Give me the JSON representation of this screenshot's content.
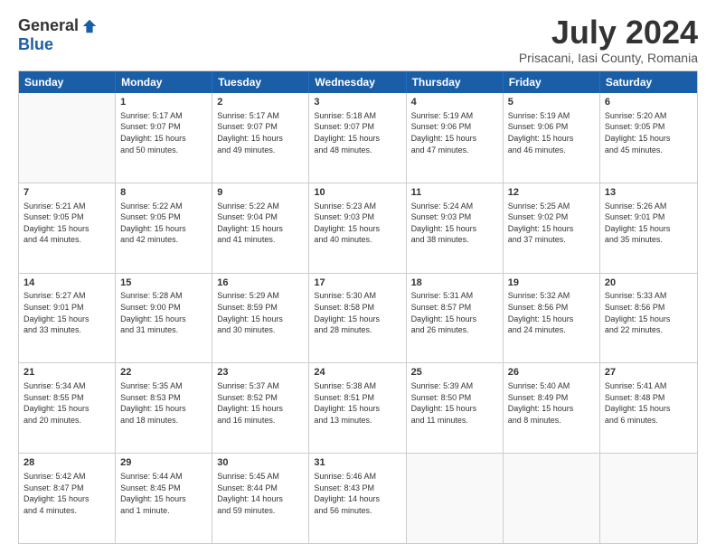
{
  "header": {
    "logo_general": "General",
    "logo_blue": "Blue",
    "month_title": "July 2024",
    "location": "Prisacani, Iasi County, Romania"
  },
  "days_of_week": [
    "Sunday",
    "Monday",
    "Tuesday",
    "Wednesday",
    "Thursday",
    "Friday",
    "Saturday"
  ],
  "weeks": [
    [
      {
        "day": "",
        "text": ""
      },
      {
        "day": "1",
        "text": "Sunrise: 5:17 AM\nSunset: 9:07 PM\nDaylight: 15 hours\nand 50 minutes."
      },
      {
        "day": "2",
        "text": "Sunrise: 5:17 AM\nSunset: 9:07 PM\nDaylight: 15 hours\nand 49 minutes."
      },
      {
        "day": "3",
        "text": "Sunrise: 5:18 AM\nSunset: 9:07 PM\nDaylight: 15 hours\nand 48 minutes."
      },
      {
        "day": "4",
        "text": "Sunrise: 5:19 AM\nSunset: 9:06 PM\nDaylight: 15 hours\nand 47 minutes."
      },
      {
        "day": "5",
        "text": "Sunrise: 5:19 AM\nSunset: 9:06 PM\nDaylight: 15 hours\nand 46 minutes."
      },
      {
        "day": "6",
        "text": "Sunrise: 5:20 AM\nSunset: 9:05 PM\nDaylight: 15 hours\nand 45 minutes."
      }
    ],
    [
      {
        "day": "7",
        "text": "Sunrise: 5:21 AM\nSunset: 9:05 PM\nDaylight: 15 hours\nand 44 minutes."
      },
      {
        "day": "8",
        "text": "Sunrise: 5:22 AM\nSunset: 9:05 PM\nDaylight: 15 hours\nand 42 minutes."
      },
      {
        "day": "9",
        "text": "Sunrise: 5:22 AM\nSunset: 9:04 PM\nDaylight: 15 hours\nand 41 minutes."
      },
      {
        "day": "10",
        "text": "Sunrise: 5:23 AM\nSunset: 9:03 PM\nDaylight: 15 hours\nand 40 minutes."
      },
      {
        "day": "11",
        "text": "Sunrise: 5:24 AM\nSunset: 9:03 PM\nDaylight: 15 hours\nand 38 minutes."
      },
      {
        "day": "12",
        "text": "Sunrise: 5:25 AM\nSunset: 9:02 PM\nDaylight: 15 hours\nand 37 minutes."
      },
      {
        "day": "13",
        "text": "Sunrise: 5:26 AM\nSunset: 9:01 PM\nDaylight: 15 hours\nand 35 minutes."
      }
    ],
    [
      {
        "day": "14",
        "text": "Sunrise: 5:27 AM\nSunset: 9:01 PM\nDaylight: 15 hours\nand 33 minutes."
      },
      {
        "day": "15",
        "text": "Sunrise: 5:28 AM\nSunset: 9:00 PM\nDaylight: 15 hours\nand 31 minutes."
      },
      {
        "day": "16",
        "text": "Sunrise: 5:29 AM\nSunset: 8:59 PM\nDaylight: 15 hours\nand 30 minutes."
      },
      {
        "day": "17",
        "text": "Sunrise: 5:30 AM\nSunset: 8:58 PM\nDaylight: 15 hours\nand 28 minutes."
      },
      {
        "day": "18",
        "text": "Sunrise: 5:31 AM\nSunset: 8:57 PM\nDaylight: 15 hours\nand 26 minutes."
      },
      {
        "day": "19",
        "text": "Sunrise: 5:32 AM\nSunset: 8:56 PM\nDaylight: 15 hours\nand 24 minutes."
      },
      {
        "day": "20",
        "text": "Sunrise: 5:33 AM\nSunset: 8:56 PM\nDaylight: 15 hours\nand 22 minutes."
      }
    ],
    [
      {
        "day": "21",
        "text": "Sunrise: 5:34 AM\nSunset: 8:55 PM\nDaylight: 15 hours\nand 20 minutes."
      },
      {
        "day": "22",
        "text": "Sunrise: 5:35 AM\nSunset: 8:53 PM\nDaylight: 15 hours\nand 18 minutes."
      },
      {
        "day": "23",
        "text": "Sunrise: 5:37 AM\nSunset: 8:52 PM\nDaylight: 15 hours\nand 16 minutes."
      },
      {
        "day": "24",
        "text": "Sunrise: 5:38 AM\nSunset: 8:51 PM\nDaylight: 15 hours\nand 13 minutes."
      },
      {
        "day": "25",
        "text": "Sunrise: 5:39 AM\nSunset: 8:50 PM\nDaylight: 15 hours\nand 11 minutes."
      },
      {
        "day": "26",
        "text": "Sunrise: 5:40 AM\nSunset: 8:49 PM\nDaylight: 15 hours\nand 8 minutes."
      },
      {
        "day": "27",
        "text": "Sunrise: 5:41 AM\nSunset: 8:48 PM\nDaylight: 15 hours\nand 6 minutes."
      }
    ],
    [
      {
        "day": "28",
        "text": "Sunrise: 5:42 AM\nSunset: 8:47 PM\nDaylight: 15 hours\nand 4 minutes."
      },
      {
        "day": "29",
        "text": "Sunrise: 5:44 AM\nSunset: 8:45 PM\nDaylight: 15 hours\nand 1 minute."
      },
      {
        "day": "30",
        "text": "Sunrise: 5:45 AM\nSunset: 8:44 PM\nDaylight: 14 hours\nand 59 minutes."
      },
      {
        "day": "31",
        "text": "Sunrise: 5:46 AM\nSunset: 8:43 PM\nDaylight: 14 hours\nand 56 minutes."
      },
      {
        "day": "",
        "text": ""
      },
      {
        "day": "",
        "text": ""
      },
      {
        "day": "",
        "text": ""
      }
    ]
  ]
}
